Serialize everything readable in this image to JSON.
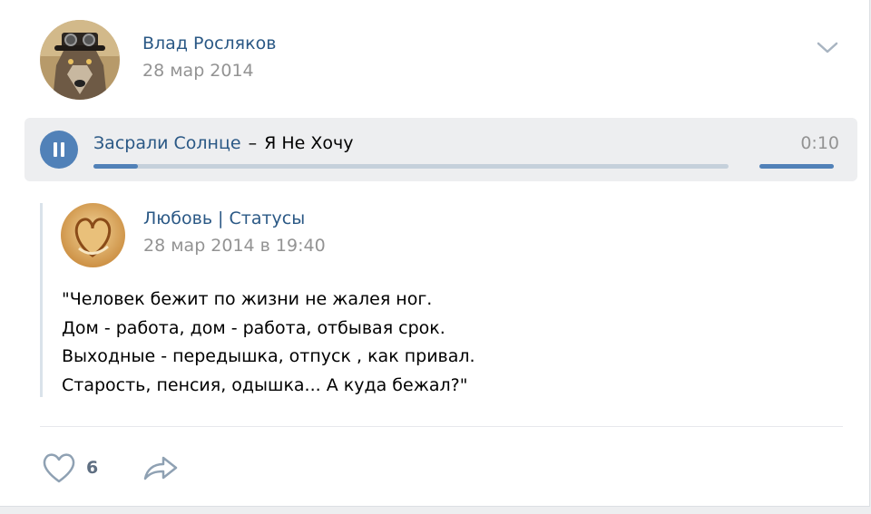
{
  "post": {
    "author_name": "Влад Росляков",
    "date": "28 мар 2014"
  },
  "audio": {
    "artist": "Засрали Солнце",
    "dash": "–",
    "title": "Я Не Хочу",
    "time": "0:10",
    "progress_fraction": 0.07,
    "volume_fraction": 1.0
  },
  "repost": {
    "source_name": "Любовь | Статусы",
    "date": "28 мар 2014 в 19:40",
    "text_lines": [
      "\"Человек бежит по жизни не жалея ног.",
      "Дом - работа, дом - работа, отбывая срок.",
      "Выходные - передышка, отпуск , как привал.",
      "Старость, пенсия, одышка... А куда бежал?\""
    ]
  },
  "actions": {
    "like_count": "6"
  },
  "colors": {
    "link": "#2a5885",
    "accent": "#5181b8",
    "muted": "#939393",
    "audio_bg": "#edeef0"
  },
  "icons": {
    "menu": "chevron-down-icon",
    "play": "pause-icon",
    "like": "heart-icon",
    "share": "share-arrow-icon"
  }
}
